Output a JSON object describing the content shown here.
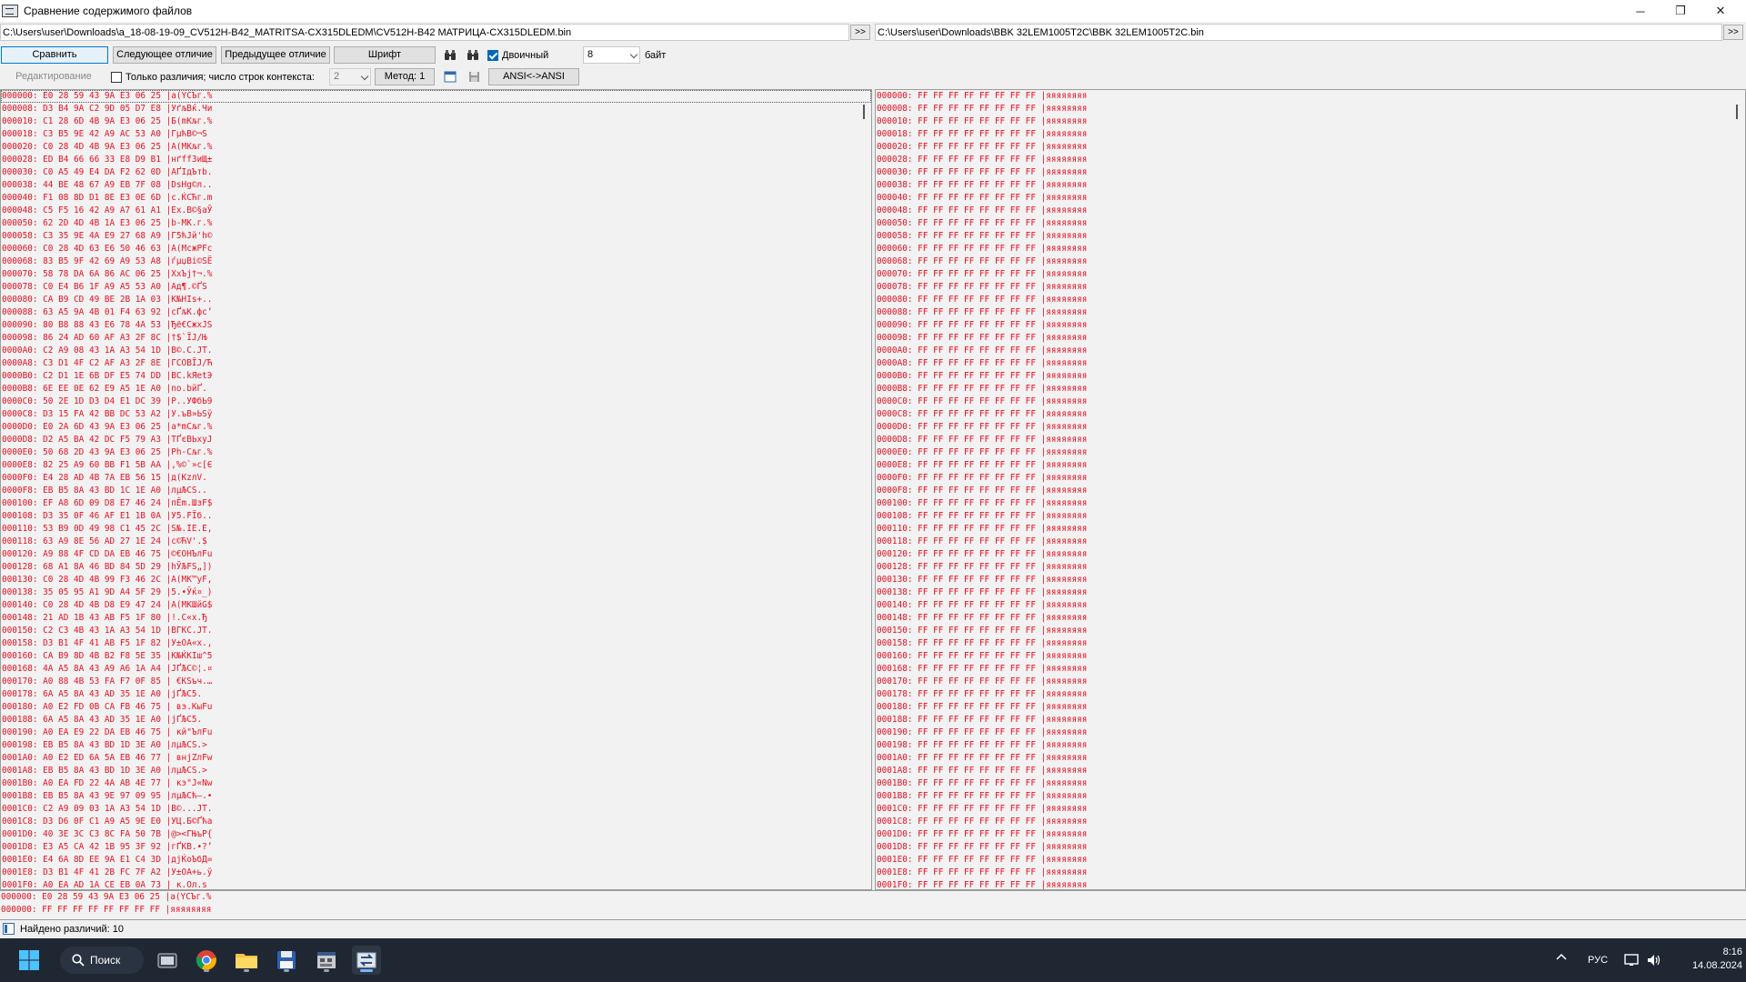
{
  "window": {
    "title": "Сравнение содержимого файлов",
    "minimize_glyph": "─",
    "maximize_glyph": "❐",
    "close_glyph": "✕"
  },
  "paths": {
    "left": "C:\\Users\\user\\Downloads\\a_18-08-19-09_CV512H-B42_MATRITSA-CX315DLEDM\\CV512H-B42 МАТРИЦА-CX315DLEDM.bin",
    "right": "C:\\Users\\user\\Downloads\\BBK 32LEM1005T2C\\BBK 32LEM1005T2C.bin",
    "browse_label": ">>"
  },
  "toolbar": {
    "compare": "Сравнить",
    "next_diff": "Следующее отличие",
    "prev_diff": "Предыдущее отличие",
    "font": "Шрифт",
    "binary_label": "Двоичный",
    "binary_checked": true,
    "bytes_value": "8",
    "bytes_unit": "байт",
    "find_icon": "binoculars-icon",
    "find_next_icon": "binoculars-next-icon"
  },
  "toolbar2": {
    "edit": "Редактирование",
    "only_diff_label": "Только различия; число строк контекста:",
    "only_diff_checked": false,
    "context_value": "2",
    "method": "Метод: 1",
    "ansi": "ANSI<->ANSI",
    "view_icon": "window-icon",
    "save_icon": "save-icon"
  },
  "left_rows": [
    "000000: E0 28 59 43 9A E3 06 25 |а(YCЪг.%",
    "000008: D3 B4 9A C2 9D 05 D7 E8 |УґљВќ.Чи",
    "000010: C1 28 6D 4B 9A E3 06 25 |Б(mKљг.%",
    "000018: C3 B5 9E 42 A9 AC 53 A0 |ГµћB©¬S ",
    "000020: C0 28 4D 4B 9A E3 06 25 |А(MKљг.%",
    "000028: ED B4 66 66 33 E8 D9 B1 |нґff3иЩ±",
    "000030: C0 A5 49 E4 DA F2 62 0D |АҐIдЪтb.",
    "000038: 44 BE 48 67 A9 EB 7F 08 |DѕHg©л..",
    "000040: F1 08 8D D1 8E E3 0E 6D |с.ЌСЋг.m",
    "000048: C5 F5 16 42 A9 A7 61 A1 |Ех.B©§aЎ",
    "000050: 62 2D 4D 4B 1A E3 06 25 |b-MK.г.%",
    "000058: C3 35 9E 4A E9 27 68 A9 |Г5ћJй'h©",
    "000060: C0 28 4D 63 E6 50 46 63 |А(McжPFc",
    "000068: 83 B5 9F 42 69 A9 53 A8 |ѓµџBi©SЁ",
    "000070: 58 78 DA 6A 86 AC 06 25 |XxЪj†¬.%",
    "000078: C0 E4 B6 1F A9 A5 53 A0 |Ад¶.©ҐS ",
    "000080: CA B9 CD 49 BE 2B 1A 03 |К№НIѕ+..",
    "000088: 63 A5 9A 4B 01 F4 63 92 |cҐљK.фc’",
    "000090: 80 B8 88 43 E6 78 4A 53 |Ђё€CжxJS",
    "000098: 86 24 AD 60 AF A3 2F 8C |†$­`ЇЈ/Њ",
    "0000A0: C2 A9 08 43 1A A3 54 1D |В©.C.ЈT.",
    "0000A8: C3 D1 4F C2 AF A3 2F 8E |ГСOВЇЈ/Ћ",
    "0000B0: C2 D1 1E 6B DF E5 74 DD |ВС.kЯetЭ",
    "0000B8: 6E EE 0E 62 E9 A5 1E A0 |nо.bйҐ. ",
    "0000C0: 50 2E 1D D3 D4 E1 DC 39 |P..УФбЬ9",
    "0000C8: D3 15 FA 42 BB DC 53 A2 |У.ъB»ЬSў",
    "0000D0: E0 2A 6D 43 9A E3 06 25 |а*mCљг.%",
    "0000D8: D2 A5 BA 42 DC F5 79 A3 |ТҐєBЬхyЈ",
    "0000E0: 50 68 2D 43 9A E3 06 25 |Ph-Cљг.%",
    "0000E8: 82 25 A9 60 BB F1 5B AA |‚%©`»с[Є",
    "0000F0: E4 28 AD 4B 7A EB 56 15 |д(­KzлV.",
    "0000F8: EB B5 8A 43 BD 1C 1E A0 |лµЉCЅ.. ",
    "000100: EF A8 6D 09 D8 E7 46 24 |пЁm.ШзF$",
    "000108: D3 35 0F 46 AF E1 1B 0A |У5.FЇб..",
    "000110: 53 B9 0D 49 98 C1 45 2C |S№.IЕ.E,",
    "000118: 63 A9 8E 56 AD 27 1E 24 |c©ЋV­'.$",
    "000120: A9 88 4F CD DA EB 46 75 |©€OНЪлFu",
    "000128: 68 A1 8A 46 BD 84 5D 29 |hЎЉFЅ„])",
    "000130: C0 28 4D 4B 99 F3 46 2C |А(MK™уF,",
    "000138: 35 05 95 A1 9D A4 5F 29 |5.•Ўќ¤_)",
    "000140: C0 28 4D 4B D8 E9 47 24 |А(MKШйG$",
    "000148: 21 AD 1B 43 AB F5 1F 80 |!­.C«х.Ђ",
    "000150: C2 C3 4B 43 1A A3 54 1D |ВГKC.ЈT.",
    "000158: D3 B1 4F 41 AB F5 1F 82 |У±OA«х.‚",
    "000160: CA B9 8D 4B B2 F8 5E 35 |К№ЌKІш^5",
    "000168: 4A A5 8A 43 A9 A6 1A A4 |JҐЉC©¦.¤",
    "000170: A0 88 4B 53 FA F7 0F 85 | €KSъч.…",
    "000178: 6A A5 8A 43 AD 35 1E A0 |jҐЉC­5. ",
    "000180: A0 E2 FD 0B CA FB 46 75 | вэ.КыFu",
    "000188: 6A A5 8A 43 AD 35 1E A0 |jҐЉC­5. ",
    "000190: A0 EA E9 22 DA EB 46 75 | кй\"ЪлFu",
    "000198: EB B5 8A 43 BD 1D 3E A0 |лµЉCЅ.> ",
    "0001A0: A0 E2 ED 6A 5A EB 46 77 | внjZлFw",
    "0001A8: EB B5 8A 43 BD 1D 3E A0 |лµЉCЅ.> ",
    "0001B0: A0 EA FD 22 4A AB 4E 77 | кэ\"J«Nw",
    "0001B8: EB B5 8A 43 9E 97 09 95 |лµЉCћ—.•",
    "0001C0: C2 A9 09 03 1A A3 54 1D |В©...ЈT.",
    "0001C8: D3 D6 0F C1 A9 A5 9E E0 |УЦ.Б©Ґћа",
    "0001D0: 40 3E 3C C3 8C FA 50 7B |@><ГЊъP{",
    "0001D8: E3 A5 CA 42 1B 95 3F 92 |гҐКB.•?’",
    "0001E0: E4 6A 8D EE 9A E1 C4 3D |дjЌоЪбД=",
    "0001E8: D3 B1 4F 41 2B FC 7F A2 |У±OA+ь.ў",
    "0001F0: A0 EA AD 1A CE EB 0A 73 | к­.Ол.s"
  ],
  "right_rows": [
    "000000: FF FF FF FF FF FF FF FF |яяяяяяяя",
    "000008: FF FF FF FF FF FF FF FF |яяяяяяяя",
    "000010: FF FF FF FF FF FF FF FF |яяяяяяяя",
    "000018: FF FF FF FF FF FF FF FF |яяяяяяяя",
    "000020: FF FF FF FF FF FF FF FF |яяяяяяяя",
    "000028: FF FF FF FF FF FF FF FF |яяяяяяяя",
    "000030: FF FF FF FF FF FF FF FF |яяяяяяяя",
    "000038: FF FF FF FF FF FF FF FF |яяяяяяяя",
    "000040: FF FF FF FF FF FF FF FF |яяяяяяяя",
    "000048: FF FF FF FF FF FF FF FF |яяяяяяяя",
    "000050: FF FF FF FF FF FF FF FF |яяяяяяяя",
    "000058: FF FF FF FF FF FF FF FF |яяяяяяяя",
    "000060: FF FF FF FF FF FF FF FF |яяяяяяяя",
    "000068: FF FF FF FF FF FF FF FF |яяяяяяяя",
    "000070: FF FF FF FF FF FF FF FF |яяяяяяяя",
    "000078: FF FF FF FF FF FF FF FF |яяяяяяяя",
    "000080: FF FF FF FF FF FF FF FF |яяяяяяяя",
    "000088: FF FF FF FF FF FF FF FF |яяяяяяяя",
    "000090: FF FF FF FF FF FF FF FF |яяяяяяяя",
    "000098: FF FF FF FF FF FF FF FF |яяяяяяяя",
    "0000A0: FF FF FF FF FF FF FF FF |яяяяяяяя",
    "0000A8: FF FF FF FF FF FF FF FF |яяяяяяяя",
    "0000B0: FF FF FF FF FF FF FF FF |яяяяяяяя",
    "0000B8: FF FF FF FF FF FF FF FF |яяяяяяяя",
    "0000C0: FF FF FF FF FF FF FF FF |яяяяяяяя",
    "0000C8: FF FF FF FF FF FF FF FF |яяяяяяяя",
    "0000D0: FF FF FF FF FF FF FF FF |яяяяяяяя",
    "0000D8: FF FF FF FF FF FF FF FF |яяяяяяяя",
    "0000E0: FF FF FF FF FF FF FF FF |яяяяяяяя",
    "0000E8: FF FF FF FF FF FF FF FF |яяяяяяяя",
    "0000F0: FF FF FF FF FF FF FF FF |яяяяяяяя",
    "0000F8: FF FF FF FF FF FF FF FF |яяяяяяяя",
    "000100: FF FF FF FF FF FF FF FF |яяяяяяяя",
    "000108: FF FF FF FF FF FF FF FF |яяяяяяяя",
    "000110: FF FF FF FF FF FF FF FF |яяяяяяяя",
    "000118: FF FF FF FF FF FF FF FF |яяяяяяяя",
    "000120: FF FF FF FF FF FF FF FF |яяяяяяяя",
    "000128: FF FF FF FF FF FF FF FF |яяяяяяяя",
    "000130: FF FF FF FF FF FF FF FF |яяяяяяяя",
    "000138: FF FF FF FF FF FF FF FF |яяяяяяяя",
    "000140: FF FF FF FF FF FF FF FF |яяяяяяяя",
    "000148: FF FF FF FF FF FF FF FF |яяяяяяяя",
    "000150: FF FF FF FF FF FF FF FF |яяяяяяяя",
    "000158: FF FF FF FF FF FF FF FF |яяяяяяяя",
    "000160: FF FF FF FF FF FF FF FF |яяяяяяяя",
    "000168: FF FF FF FF FF FF FF FF |яяяяяяяя",
    "000170: FF FF FF FF FF FF FF FF |яяяяяяяя",
    "000178: FF FF FF FF FF FF FF FF |яяяяяяяя",
    "000180: FF FF FF FF FF FF FF FF |яяяяяяяя",
    "000188: FF FF FF FF FF FF FF FF |яяяяяяяя",
    "000190: FF FF FF FF FF FF FF FF |яяяяяяяя",
    "000198: FF FF FF FF FF FF FF FF |яяяяяяяя",
    "0001A0: FF FF FF FF FF FF FF FF |яяяяяяяя",
    "0001A8: FF FF FF FF FF FF FF FF |яяяяяяяя",
    "0001B0: FF FF FF FF FF FF FF FF |яяяяяяяя",
    "0001B8: FF FF FF FF FF FF FF FF |яяяяяяяя",
    "0001C0: FF FF FF FF FF FF FF FF |яяяяяяяя",
    "0001C8: FF FF FF FF FF FF FF FF |яяяяяяяя",
    "0001D0: FF FF FF FF FF FF FF FF |яяяяяяяя",
    "0001D8: FF FF FF FF FF FF FF FF |яяяяяяяя",
    "0001E0: FF FF FF FF FF FF FF FF |яяяяяяяя",
    "0001E8: FF FF FF FF FF FF FF FF |яяяяяяяя",
    "0001F0: FF FF FF FF FF FF FF FF |яяяяяяяя"
  ],
  "compare_rows": [
    "000000: E0 28 59 43 9A E3 06 25 |а(YCЪг.%",
    "000000: FF FF FF FF FF FF FF FF |яяяяяяяя"
  ],
  "status": {
    "text": "Найдено различий: 10",
    "icon": "panel-icon"
  },
  "taskbar": {
    "search_label": "Поиск",
    "language": "РУС",
    "time": "8:16",
    "date": "14.08.2024",
    "accent_color": "#75b6ff"
  }
}
